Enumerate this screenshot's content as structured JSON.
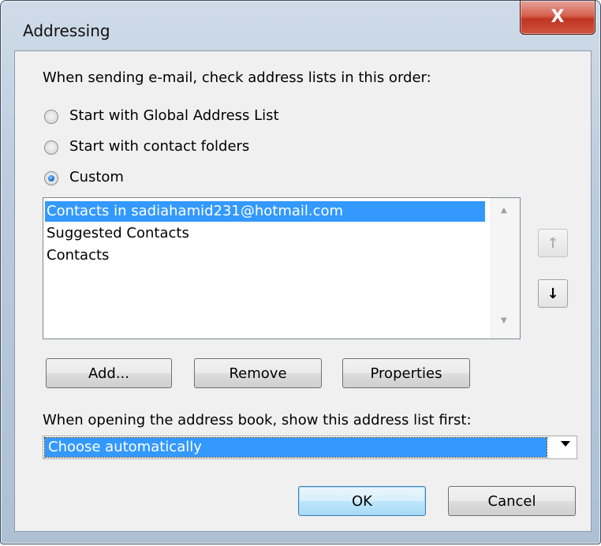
{
  "window": {
    "title": "Addressing",
    "close_glyph": "X"
  },
  "section1": {
    "instruction": "When sending e-mail, check address lists in this order:",
    "radios": [
      {
        "label": "Start with Global Address List",
        "checked": false
      },
      {
        "label": "Start with contact folders",
        "checked": false
      },
      {
        "label": "Custom",
        "checked": true
      }
    ]
  },
  "address_list": {
    "items": [
      {
        "label": "Contacts in sadiahamid231@hotmail.com",
        "selected": true
      },
      {
        "label": "Suggested Contacts",
        "selected": false
      },
      {
        "label": "Contacts",
        "selected": false
      }
    ],
    "move_up_glyph": "↑",
    "move_down_glyph": "↓"
  },
  "list_buttons": {
    "add": "Add...",
    "remove": "Remove",
    "properties": "Properties"
  },
  "section2": {
    "instruction": "When opening the address book, show this address list first:",
    "selected_value": "Choose automatically"
  },
  "footer": {
    "ok": "OK",
    "cancel": "Cancel"
  },
  "colors": {
    "selection": "#3399ff",
    "dialog_bg": "#f0f0f0",
    "close_button": "#c0341f"
  }
}
